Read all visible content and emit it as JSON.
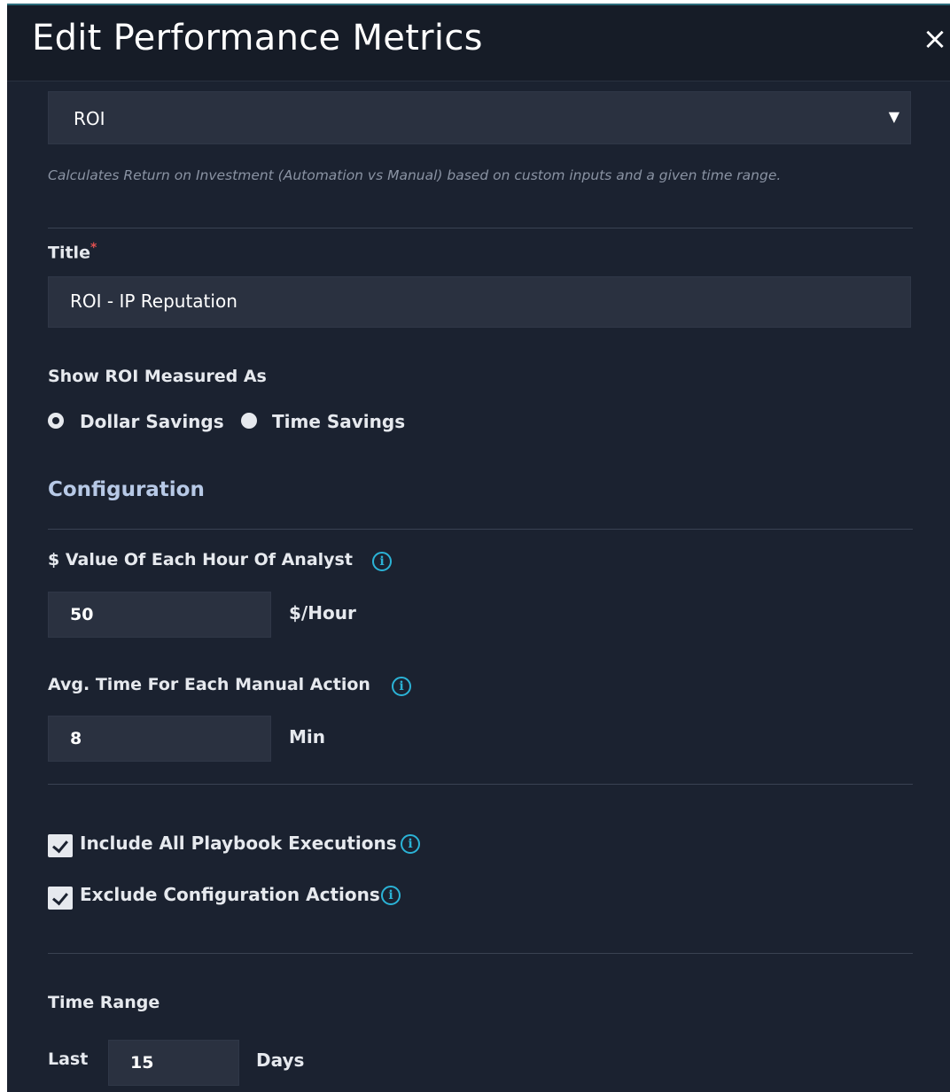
{
  "header": {
    "title": "Edit Performance Metrics",
    "close_icon": "×"
  },
  "metric_select": {
    "value": "ROI",
    "arrow": "▼",
    "description": "Calculates Return on Investment (Automation vs Manual) based on custom inputs and a given time range."
  },
  "title_field": {
    "label": "Title",
    "required_mark": "*",
    "value": "ROI - IP Reputation"
  },
  "measure": {
    "label": "Show ROI Measured As",
    "options": [
      {
        "label": "Dollar Savings",
        "selected": true
      },
      {
        "label": "Time Savings",
        "selected": false
      }
    ]
  },
  "configuration": {
    "heading": "Configuration",
    "hour_value": {
      "label": "$ Value Of Each Hour Of Analyst",
      "value": "50",
      "unit": "$/Hour"
    },
    "avg_time": {
      "label": "Avg. Time For Each Manual Action",
      "value": "8",
      "unit": "Min"
    },
    "info_glyph": "i"
  },
  "options": {
    "include_all": {
      "label": "Include All Playbook Executions",
      "checked": true
    },
    "exclude_config": {
      "label": "Exclude Configuration Actions",
      "checked": true
    }
  },
  "time_range": {
    "label": "Time Range",
    "prefix": "Last",
    "value": "15",
    "unit": "Days"
  }
}
